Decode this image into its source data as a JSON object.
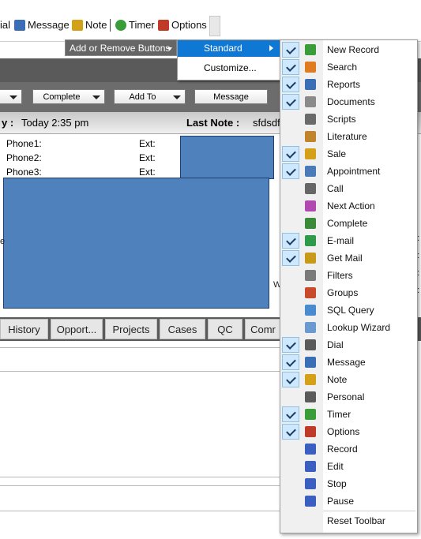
{
  "toolbar": {
    "items": [
      {
        "label": "ial",
        "icon": "dial-icon"
      },
      {
        "label": "Message",
        "icon": "message-icon"
      },
      {
        "label": "Note",
        "icon": "note-icon"
      },
      {
        "label": "Timer",
        "icon": "timer-icon"
      },
      {
        "label": "Options",
        "icon": "options-icon"
      }
    ]
  },
  "add_remove": {
    "label": "Add or Remove Buttons",
    "submenu": {
      "standard": "Standard",
      "customize": "Customize..."
    }
  },
  "action_buttons": [
    "Complete",
    "Add To",
    "Message"
  ],
  "infobar": {
    "left_label": "y :",
    "left_value": "Today 2:35 pm",
    "right_label": "Last Note :",
    "right_value": "sfdsdf"
  },
  "phones": [
    {
      "label": "Phone1:",
      "ext": "Ext:"
    },
    {
      "label": "Phone2:",
      "ext": "Ext:"
    },
    {
      "label": "Phone3:",
      "ext": "Ext:"
    }
  ],
  "tabs": [
    "History",
    "Opport...",
    "Projects",
    "Cases",
    "QC",
    "Comr"
  ],
  "right_edge_chars": [
    "e:",
    "e:",
    "e:",
    "e:",
    "e:"
  ],
  "right_w": "W",
  "menu": {
    "items": [
      {
        "label": "New Record",
        "checked": true,
        "icon": "new-record-icon",
        "color": "#3a9d3a"
      },
      {
        "label": "Search",
        "checked": true,
        "icon": "search-icon",
        "color": "#e07b21"
      },
      {
        "label": "Reports",
        "checked": true,
        "icon": "reports-icon",
        "color": "#3a6fb5"
      },
      {
        "label": "Documents",
        "checked": true,
        "icon": "documents-icon",
        "color": "#8a8a8a"
      },
      {
        "label": "Scripts",
        "checked": false,
        "icon": "scripts-icon",
        "color": "#6a6a6a"
      },
      {
        "label": "Literature",
        "checked": false,
        "icon": "literature-icon",
        "color": "#c0842c"
      },
      {
        "label": "Sale",
        "checked": true,
        "icon": "sale-icon",
        "color": "#d4a017"
      },
      {
        "label": "Appointment",
        "checked": true,
        "icon": "appointment-icon",
        "color": "#4a7bb8"
      },
      {
        "label": "Call",
        "checked": false,
        "icon": "call-icon",
        "color": "#666666"
      },
      {
        "label": "Next Action",
        "checked": false,
        "icon": "next-action-icon",
        "color": "#b04ab0"
      },
      {
        "label": "Complete",
        "checked": false,
        "icon": "complete-icon",
        "color": "#3a8a3a"
      },
      {
        "label": "E-mail",
        "checked": true,
        "icon": "email-icon",
        "color": "#2e9a4a"
      },
      {
        "label": "Get Mail",
        "checked": true,
        "icon": "get-mail-icon",
        "color": "#c89a1a"
      },
      {
        "label": "Filters",
        "checked": false,
        "icon": "filters-icon",
        "color": "#7a7a7a"
      },
      {
        "label": "Groups",
        "checked": false,
        "icon": "groups-icon",
        "color": "#c84a2a"
      },
      {
        "label": "SQL Query",
        "checked": false,
        "icon": "sql-query-icon",
        "color": "#4a8ad0"
      },
      {
        "label": "Lookup Wizard",
        "checked": false,
        "icon": "lookup-wizard-icon",
        "color": "#6a9ad0"
      },
      {
        "label": "Dial",
        "checked": true,
        "icon": "dial-icon",
        "color": "#5a5a5a"
      },
      {
        "label": "Message",
        "checked": true,
        "icon": "message-icon",
        "color": "#3a6fb5"
      },
      {
        "label": "Note",
        "checked": true,
        "icon": "note-icon",
        "color": "#d4a017"
      },
      {
        "label": "Personal",
        "checked": false,
        "icon": "personal-icon",
        "color": "#5a5a5a"
      },
      {
        "label": "Timer",
        "checked": true,
        "icon": "timer-icon",
        "color": "#3a9d3a"
      },
      {
        "label": "Options",
        "checked": true,
        "icon": "options-icon",
        "color": "#c03a2a"
      },
      {
        "label": "Record",
        "checked": false,
        "icon": "record-icon",
        "color": "#3a5fc0"
      },
      {
        "label": "Edit",
        "checked": false,
        "icon": "edit-icon",
        "color": "#3a5fc0"
      },
      {
        "label": "Stop",
        "checked": false,
        "icon": "stop-icon",
        "color": "#3a5fc0"
      },
      {
        "label": "Pause",
        "checked": false,
        "icon": "pause-icon",
        "color": "#3a5fc0"
      }
    ],
    "reset_label": "Reset Toolbar"
  },
  "colors": {
    "accent": "#0f78d4",
    "placeholder_block": "#4f81bd",
    "dark_band": "#5a5a5a"
  }
}
